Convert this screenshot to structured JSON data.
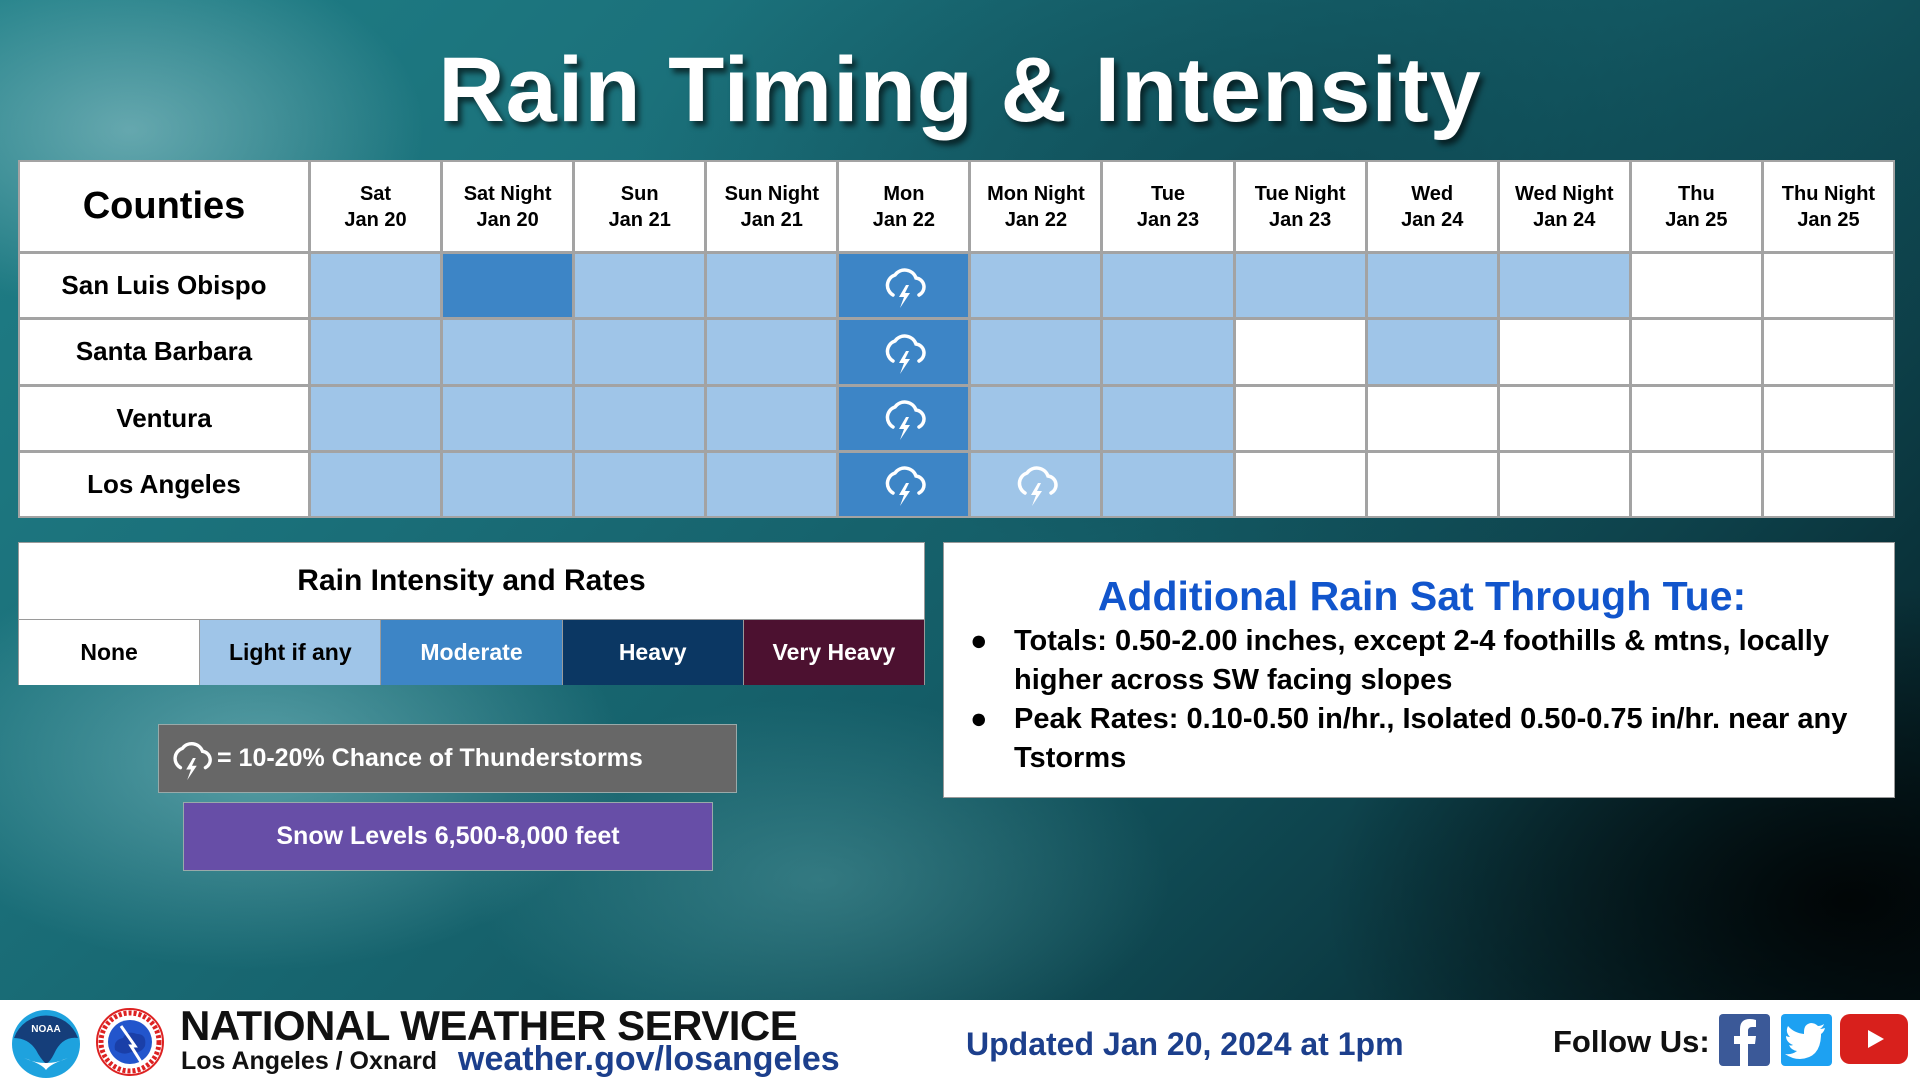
{
  "title": "Rain Timing & Intensity",
  "grid": {
    "corner_label": "Counties",
    "periods": [
      {
        "line1": "Sat",
        "line2": "Jan 20"
      },
      {
        "line1": "Sat Night",
        "line2": "Jan 20"
      },
      {
        "line1": "Sun",
        "line2": "Jan 21"
      },
      {
        "line1": "Sun Night",
        "line2": "Jan 21"
      },
      {
        "line1": "Mon",
        "line2": "Jan 22"
      },
      {
        "line1": "Mon Night",
        "line2": "Jan 22"
      },
      {
        "line1": "Tue",
        "line2": "Jan 23"
      },
      {
        "line1": "Tue Night",
        "line2": "Jan 23"
      },
      {
        "line1": "Wed",
        "line2": "Jan 24"
      },
      {
        "line1": "Wed Night",
        "line2": "Jan 24"
      },
      {
        "line1": "Thu",
        "line2": "Jan 25"
      },
      {
        "line1": "Thu Night",
        "line2": "Jan 25"
      }
    ],
    "rows": [
      {
        "county": "San Luis Obispo",
        "intensity": [
          "light",
          "moderate",
          "light",
          "light",
          "moderate",
          "light",
          "light",
          "light",
          "light",
          "light",
          "none",
          "none"
        ],
        "thunderstorm": [
          false,
          false,
          false,
          false,
          true,
          false,
          false,
          false,
          false,
          false,
          false,
          false
        ]
      },
      {
        "county": "Santa Barbara",
        "intensity": [
          "light",
          "light",
          "light",
          "light",
          "moderate",
          "light",
          "light",
          "none",
          "light",
          "none",
          "none",
          "none"
        ],
        "thunderstorm": [
          false,
          false,
          false,
          false,
          true,
          false,
          false,
          false,
          false,
          false,
          false,
          false
        ]
      },
      {
        "county": "Ventura",
        "intensity": [
          "light",
          "light",
          "light",
          "light",
          "moderate",
          "light",
          "light",
          "none",
          "none",
          "none",
          "none",
          "none"
        ],
        "thunderstorm": [
          false,
          false,
          false,
          false,
          true,
          false,
          false,
          false,
          false,
          false,
          false,
          false
        ]
      },
      {
        "county": "Los Angeles",
        "intensity": [
          "light",
          "light",
          "light",
          "light",
          "moderate",
          "light",
          "light",
          "none",
          "none",
          "none",
          "none",
          "none"
        ],
        "thunderstorm": [
          false,
          false,
          false,
          false,
          true,
          true,
          false,
          false,
          false,
          false,
          false,
          false
        ]
      }
    ]
  },
  "legend": {
    "title": "Rain Intensity and Rates",
    "levels": [
      {
        "key": "none",
        "label": "None",
        "color": "#ffffff",
        "text_color": "#000000"
      },
      {
        "key": "light",
        "label": "Light if any",
        "color": "#9fc5e8",
        "text_color": "#000000"
      },
      {
        "key": "moderate",
        "label": "Moderate",
        "color": "#3d85c6",
        "text_color": "#ffffff"
      },
      {
        "key": "heavy",
        "label": "Heavy",
        "color": "#0b3763",
        "text_color": "#ffffff"
      },
      {
        "key": "veryheavy",
        "label": "Very Heavy",
        "color": "#4c1130",
        "text_color": "#ffffff"
      }
    ]
  },
  "thunderstorm_note": {
    "icon": "thunderstorm-cloud-icon",
    "text": "= 10-20% Chance of Thunderstorms"
  },
  "snow_levels": "Snow Levels 6,500-8,000 feet",
  "info": {
    "title": "Additional Rain Sat Through Tue:",
    "bullets": [
      "Totals: 0.50-2.00 inches, except 2-4 foothills & mtns, locally higher across SW facing slopes",
      "Peak Rates: 0.10-0.50 in/hr., Isolated 0.50-0.75 in/hr. near any Tstorms"
    ],
    "title_color": "#1155cc"
  },
  "footer": {
    "org_name": "NATIONAL WEATHER SERVICE",
    "office": "Los Angeles / Oxnard",
    "url": "weather.gov/losangeles",
    "updated": "Updated Jan 20, 2024 at 1pm",
    "follow_label": "Follow Us:",
    "social": [
      {
        "name": "facebook-icon",
        "glyph": "f"
      },
      {
        "name": "twitter-icon",
        "glyph": ""
      },
      {
        "name": "youtube-icon",
        "glyph": "▶"
      }
    ],
    "logos": {
      "noaa": "NOAA",
      "nws": "NATIONAL WEATHER SERVICE"
    }
  }
}
